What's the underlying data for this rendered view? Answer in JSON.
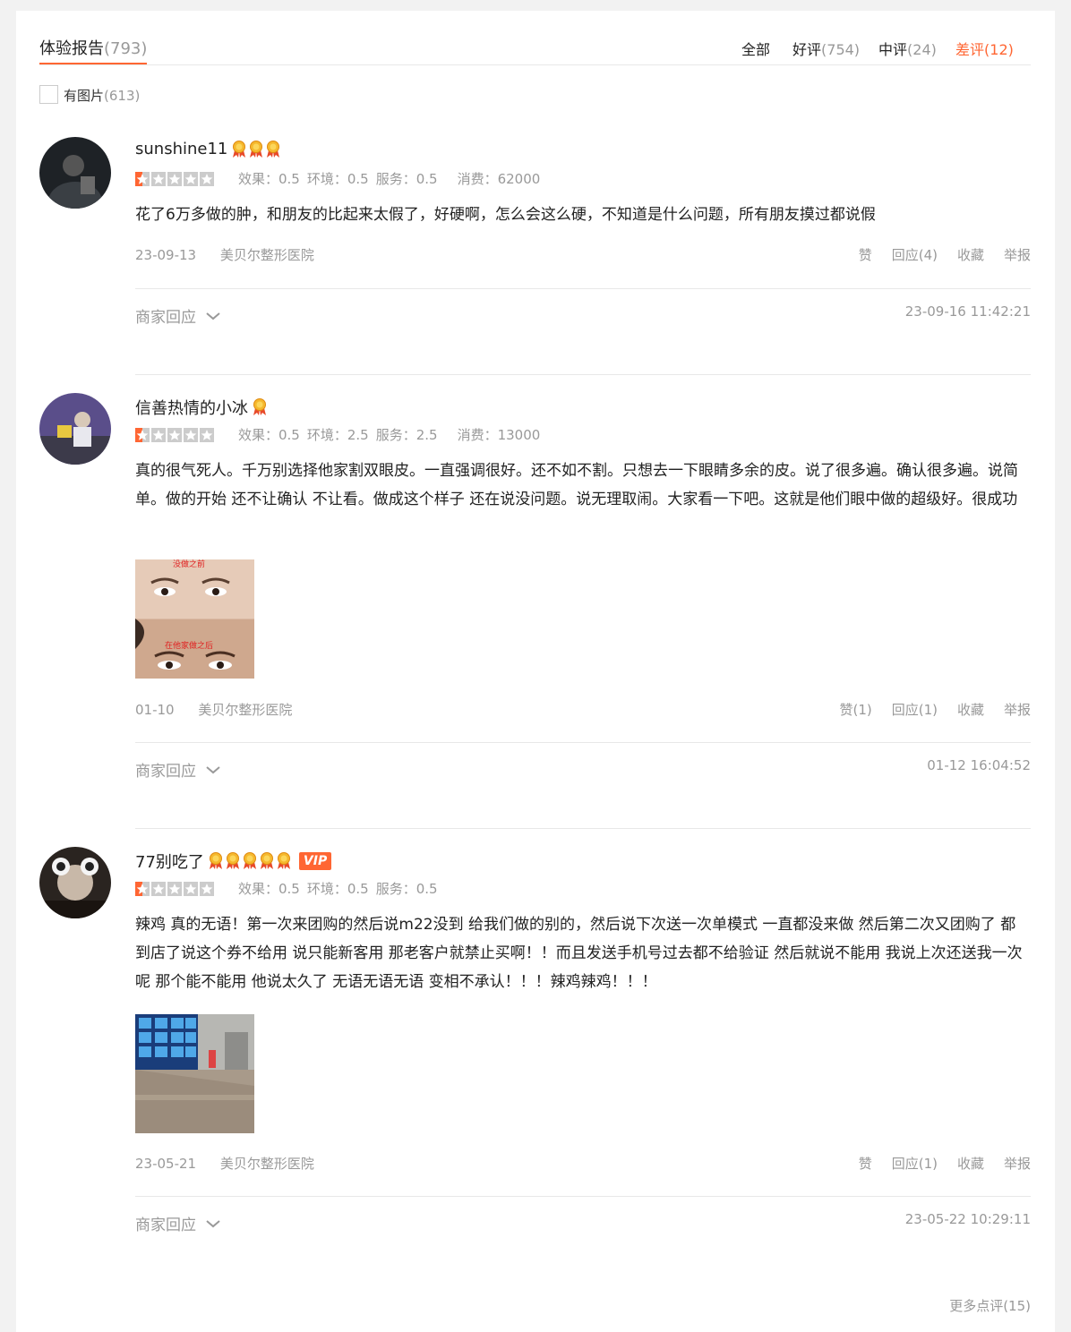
{
  "header": {
    "title": "体验报告",
    "title_count": "(793)",
    "filters": [
      {
        "label": "全部",
        "count": ""
      },
      {
        "label": "好评",
        "count": "(754)"
      },
      {
        "label": "中评",
        "count": "(24)"
      },
      {
        "label": "差评",
        "count": "(12)"
      }
    ],
    "active_filter": "差评",
    "accent_color": "#ff6633"
  },
  "photo_filter": {
    "label": "有图片",
    "count": "(613)"
  },
  "reviews": [
    {
      "username": "sunshine11",
      "medals": 3,
      "vip": "",
      "rating": 0.5,
      "scores": {
        "effect": "效果：0.5",
        "env": "环境：0.5",
        "service": "服务：0.5",
        "spend": "消费：62000"
      },
      "content": "花了6万多做的肿，和朋友的比起来太假了，好硬啊，怎么会这么硬，不知道是什么问题，所有朋友摸过都说假",
      "date": "23-09-13",
      "shop": "美贝尔整形医院",
      "actions": {
        "like": "赞",
        "reply": "回应(4)",
        "fav": "收藏",
        "report": "举报"
      },
      "merchant_reply": "商家回应",
      "merchant_time": "23-09-16 11:42:21"
    },
    {
      "username": "信善热情的小冰",
      "medals": 1,
      "vip": "",
      "rating": 0.5,
      "scores": {
        "effect": "效果：0.5",
        "env": "环境：2.5",
        "service": "服务：2.5",
        "spend": "消费：13000"
      },
      "content": "真的很气死人。千万别选择他家割双眼皮。一直强调很好。还不如不割。只想去一下眼睛多余的皮。说了很多遍。确认很多遍。说简单。做的开始 还不让确认 不让看。做成这个样子 还在说没问题。说无理取闹。大家看一下吧。这就是他们眼中做的超级好。很成功",
      "photo_captions": [
        "没做之前",
        "在他家做之后"
      ],
      "date": "01-10",
      "shop": "美贝尔整形医院",
      "actions": {
        "like": "赞(1)",
        "reply": "回应(1)",
        "fav": "收藏",
        "report": "举报"
      },
      "merchant_reply": "商家回应",
      "merchant_time": "01-12 16:04:52"
    },
    {
      "username": "77别吃了",
      "medals": 5,
      "vip": "VIP",
      "rating": 0.5,
      "scores": {
        "effect": "效果：0.5",
        "env": "环境：0.5",
        "service": "服务：0.5",
        "spend": ""
      },
      "content": "辣鸡 真的无语！第一次来团购的然后说m22没到 给我们做的别的，然后说下次送一次单模式 一直都没来做  然后第二次又团购了 都到店了说这个券不给用 说只能新客用 那老客户就禁止买啊！！而且发送手机号过去都不给验证 然后就说不能用 我说上次还送我一次呢 那个能不能用 他说太久了 无语无语无语 变相不承认！！！辣鸡辣鸡！！！",
      "date": "23-05-21",
      "shop": "美贝尔整形医院",
      "actions": {
        "like": "赞",
        "reply": "回应(1)",
        "fav": "收藏",
        "report": "举报"
      },
      "merchant_reply": "商家回应",
      "merchant_time": "23-05-22 10:29:11"
    }
  ],
  "more_link": "更多点评(15)"
}
